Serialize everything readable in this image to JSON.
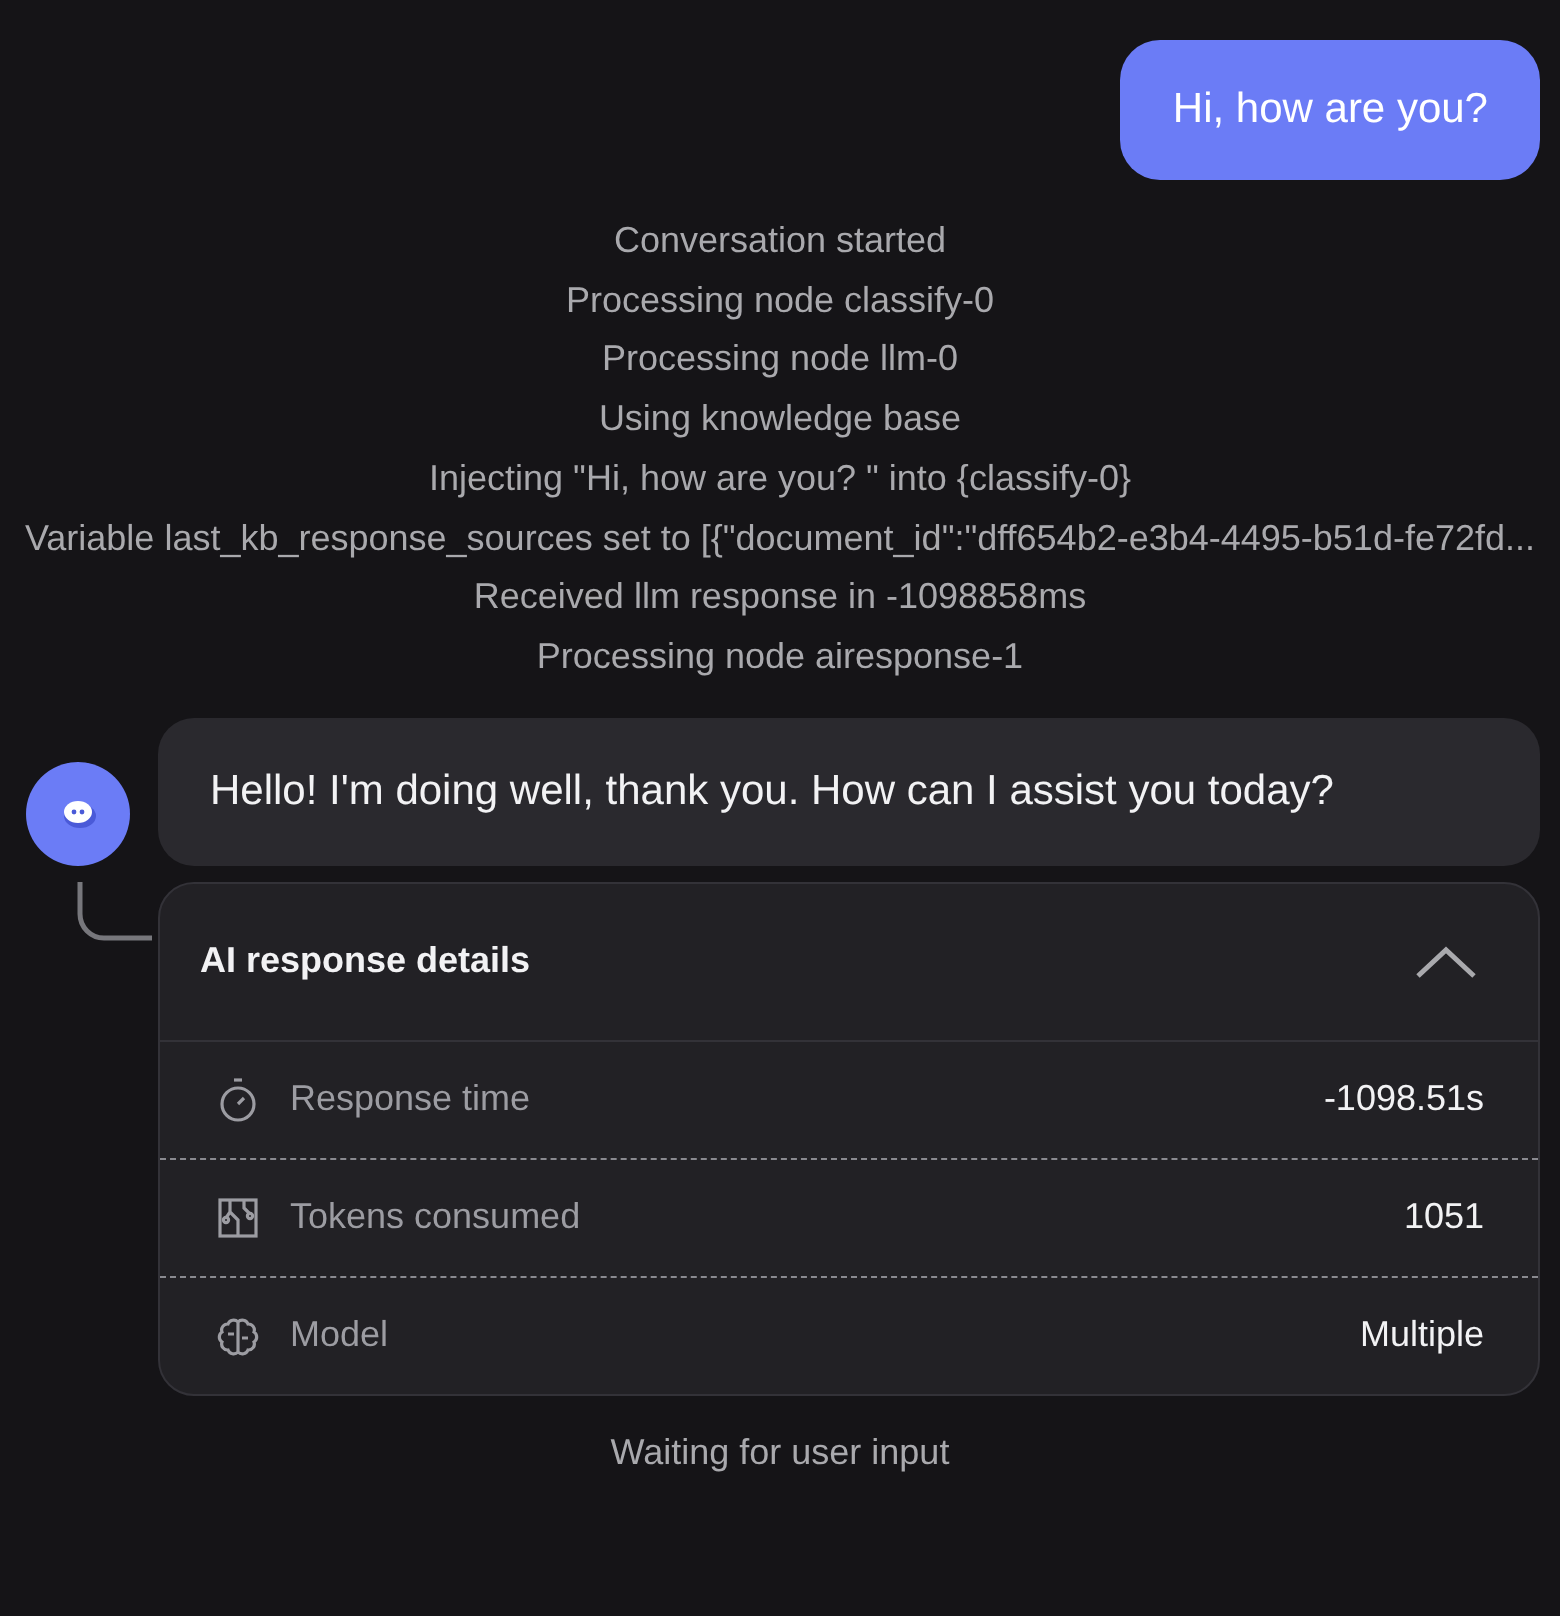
{
  "user_message": "Hi, how are you?",
  "events": [
    "Conversation started",
    "Processing node classify-0",
    "Processing node llm-0",
    "Using knowledge base",
    "Injecting \"Hi, how are you? \" into {classify-0}",
    "Variable last_kb_response_sources set to [{\"document_id\":\"dff654b2-e3b4-4495-b51d-fe72fd...",
    "Received llm response in -1098858ms",
    "Processing node airesponse-1"
  ],
  "bot_message": "Hello! I'm doing well, thank you. How can I assist you today?",
  "details": {
    "title": "AI response details",
    "expanded": true,
    "rows": [
      {
        "kind": "time",
        "label": "Response time",
        "value": "-1098.51s"
      },
      {
        "kind": "tokens",
        "label": "Tokens consumed",
        "value": "1051"
      },
      {
        "kind": "model",
        "label": "Model",
        "value": "Multiple"
      }
    ]
  },
  "status": "Waiting for user input"
}
